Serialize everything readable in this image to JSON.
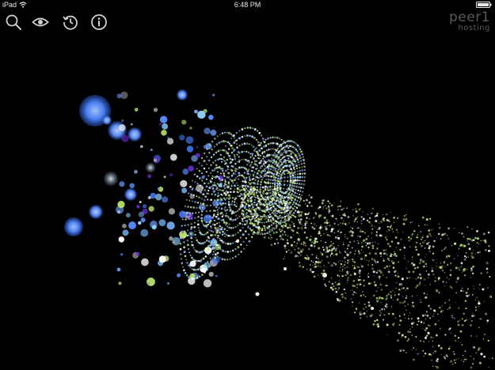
{
  "status_bar": {
    "device": "iPad",
    "time": "6:48 PM",
    "wifi_icon": "wifi-icon",
    "battery_icon": "battery-icon"
  },
  "toolbar": {
    "items": [
      {
        "icon": "search-icon"
      },
      {
        "icon": "eye-icon"
      },
      {
        "icon": "history-icon"
      },
      {
        "icon": "info-icon"
      }
    ]
  },
  "logo": {
    "name": "peer1",
    "sub": "hosting"
  },
  "colors": {
    "background": "#000000",
    "bubble_blue": "#4f86ff",
    "particle_green": "#b9e46a",
    "particle_white": "#eef6ff",
    "toolbar_icon": "#cfcfcf",
    "logo_gray": "#5a5a5a"
  }
}
